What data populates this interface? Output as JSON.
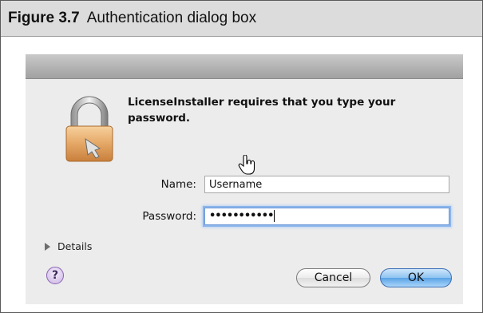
{
  "figure": {
    "number": "Figure 3.7",
    "title": "Authentication dialog box"
  },
  "dialog": {
    "message": "LicenseInstaller requires that you type your password.",
    "name_label": "Name:",
    "name_value": "Username",
    "password_label": "Password:",
    "password_value": "•••••••••••",
    "details_label": "Details",
    "help_label": "?",
    "cancel_label": "Cancel",
    "ok_label": "OK"
  },
  "icons": {
    "lock": "padlock-icon",
    "cursor": "hand-pointer-cursor-icon",
    "disclosure": "disclosure-triangle-icon",
    "help": "help-icon"
  },
  "colors": {
    "ok_button": "#5aa2e6",
    "focus_ring": "#8cb5ec",
    "dialog_bg": "#ececec"
  }
}
